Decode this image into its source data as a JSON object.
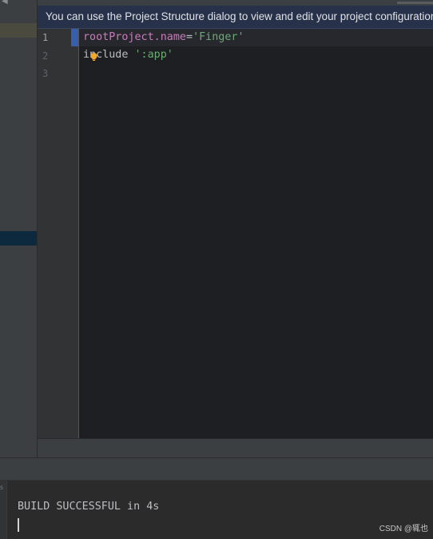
{
  "banner": {
    "text": "You can use the Project Structure dialog to view and edit your project configuration"
  },
  "editor": {
    "line_numbers": [
      "1",
      "2",
      "3"
    ],
    "line1": {
      "identifier": "rootProject.name",
      "operator": "=",
      "string": "'Finger'"
    },
    "line2": {
      "keyword": "include",
      "string": "':app'"
    },
    "intention_icon": "lightbulb-icon"
  },
  "console": {
    "output_line": "BUILD SUCCESSFUL in 4s",
    "sidebar_fragment": "s"
  },
  "watermark": "CSDN @辄也",
  "colors": {
    "editor_bg": "#1e1f22",
    "banner_bg": "#27324a",
    "property": "#c77dbb",
    "string": "#6aab73",
    "change_marker": "#375fad",
    "bulb": "#f0a732"
  }
}
